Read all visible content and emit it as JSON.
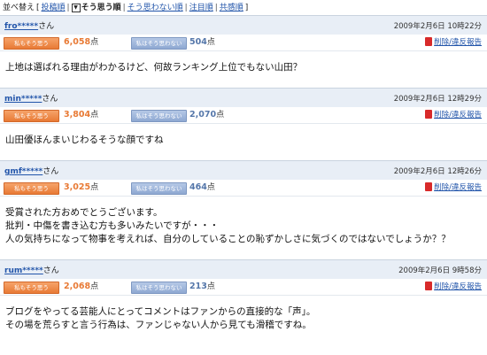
{
  "sortbar": {
    "label": "並べ替え",
    "open_bracket": "[",
    "close_bracket": "]",
    "sep": "|",
    "options": [
      {
        "label": "投稿順"
      },
      {
        "label": "そう思う順",
        "checkbox": "▼"
      },
      {
        "label": "そう思わない順"
      },
      {
        "label": "注目順"
      },
      {
        "label": "共感順"
      }
    ]
  },
  "vote_labels": {
    "agree": "私もそう思う",
    "disagree": "私はそう思わない",
    "unit": "点"
  },
  "report_label": "削除/違反報告",
  "name_suffix": "さん",
  "colors": {
    "agree": "#e87a35",
    "disagree": "#8ea8d2",
    "link": "#2255aa",
    "header_bg": "#e8eef6",
    "report_icon": "#d82a2a"
  },
  "comments": [
    {
      "user": "fro*****",
      "time": "2009年2月6日 10時22分",
      "agree": "6,058",
      "disagree": "504",
      "lines": [
        "上地は選ばれる理由がわかるけど、何故ランキング上位でもない山田？"
      ]
    },
    {
      "user": "min*****",
      "time": "2009年2月6日 12時29分",
      "agree": "3,804",
      "disagree": "2,070",
      "lines": [
        "山田優ほんまいじわるそうな顔ですね"
      ]
    },
    {
      "user": "gmf*****",
      "time": "2009年2月6日 12時26分",
      "agree": "3,025",
      "disagree": "464",
      "lines": [
        "受賞された方おめでとうございます。",
        "批判・中傷を書き込む方も多いみたいですが・・・",
        "人の気持ちになって物事を考えれば、自分のしていることの恥ずかしさに気づくのではないでしょうか？？"
      ]
    },
    {
      "user": "rum*****",
      "time": "2009年2月6日 9時58分",
      "agree": "2,068",
      "disagree": "213",
      "lines": [
        "ブログをやってる芸能人にとってコメントはファンからの直接的な「声」。",
        "その場を荒らすと言う行為は、ファンじゃない人から見ても滑稽ですね。"
      ]
    }
  ]
}
